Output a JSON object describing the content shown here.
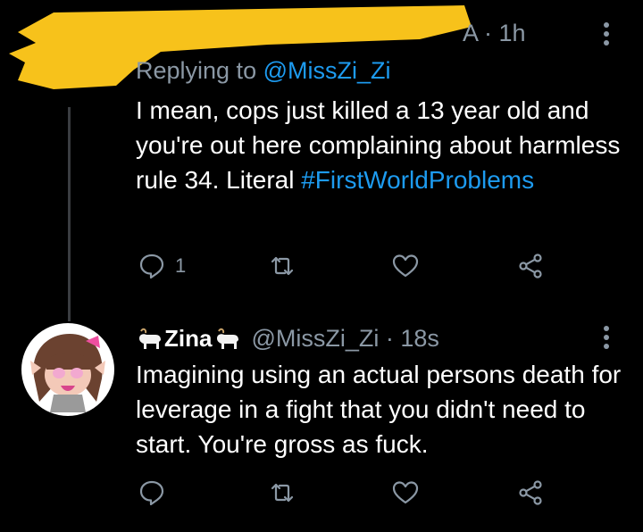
{
  "colors": {
    "background": "#000000",
    "text": "#ffffff",
    "muted": "#8b98a5",
    "link": "#1d9bf0",
    "redaction": "#f7c21b"
  },
  "tweet1": {
    "meta_tail": "A · 1h",
    "replying_prefix": "Replying to ",
    "replying_handle": "@MissZi_Zi",
    "text": "I mean,  cops just killed a 13 year old and you're out here complaining about harmless rule 34. Literal",
    "hashtag": "#FirstWorldProblems",
    "reply_count": "1"
  },
  "tweet2": {
    "display_name": "Zina",
    "name_emoji": "goat-icon",
    "handle_time": "@MissZi_Zi · 18s",
    "text": "Imagining using an actual persons death for leverage in a fight that you didn't need to start. You're gross as fuck."
  },
  "icons": {
    "more": "more-vertical-icon",
    "reply": "reply-icon",
    "retweet": "retweet-icon",
    "like": "heart-icon",
    "share": "share-icon"
  }
}
